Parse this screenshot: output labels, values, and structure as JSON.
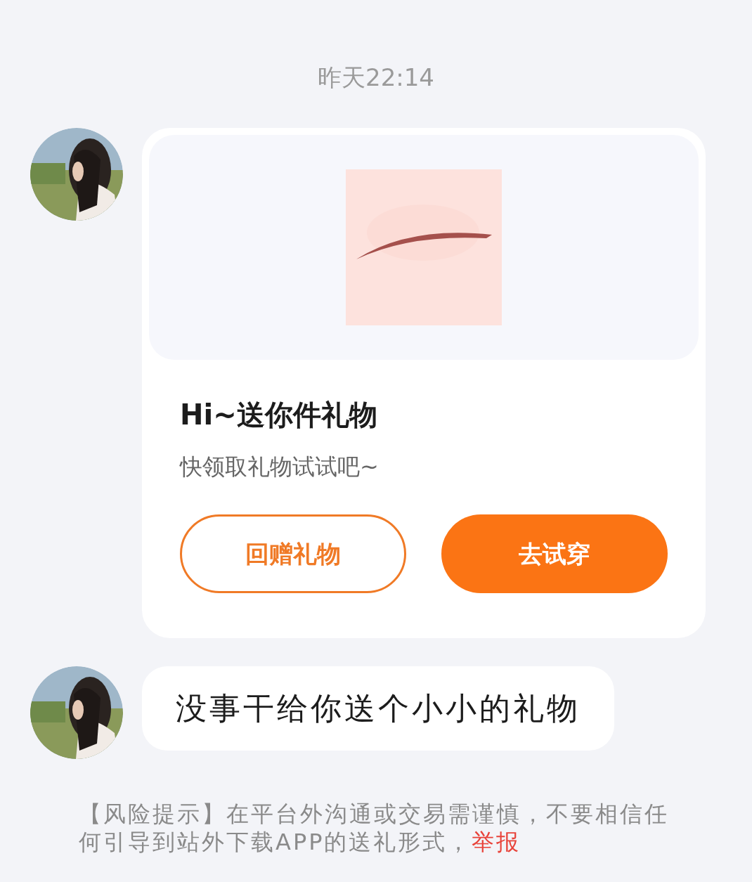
{
  "timestamp": "昨天22:14",
  "messages": [
    {
      "kind": "gift_card",
      "title": "Hi~送你件礼物",
      "subtitle": "快领取礼物试试吧~",
      "buttons": [
        {
          "label": "回赠礼物",
          "kind": "outline"
        },
        {
          "label": "去试穿",
          "kind": "filled"
        }
      ]
    },
    {
      "kind": "text",
      "text": "没事干给你送个小小的礼物"
    }
  ],
  "risk_notice": {
    "text": "【风险提示】在平台外沟通或交易需谨慎，不要相信任何引导到站外下载APP的送礼形式，",
    "link": "举报"
  }
}
